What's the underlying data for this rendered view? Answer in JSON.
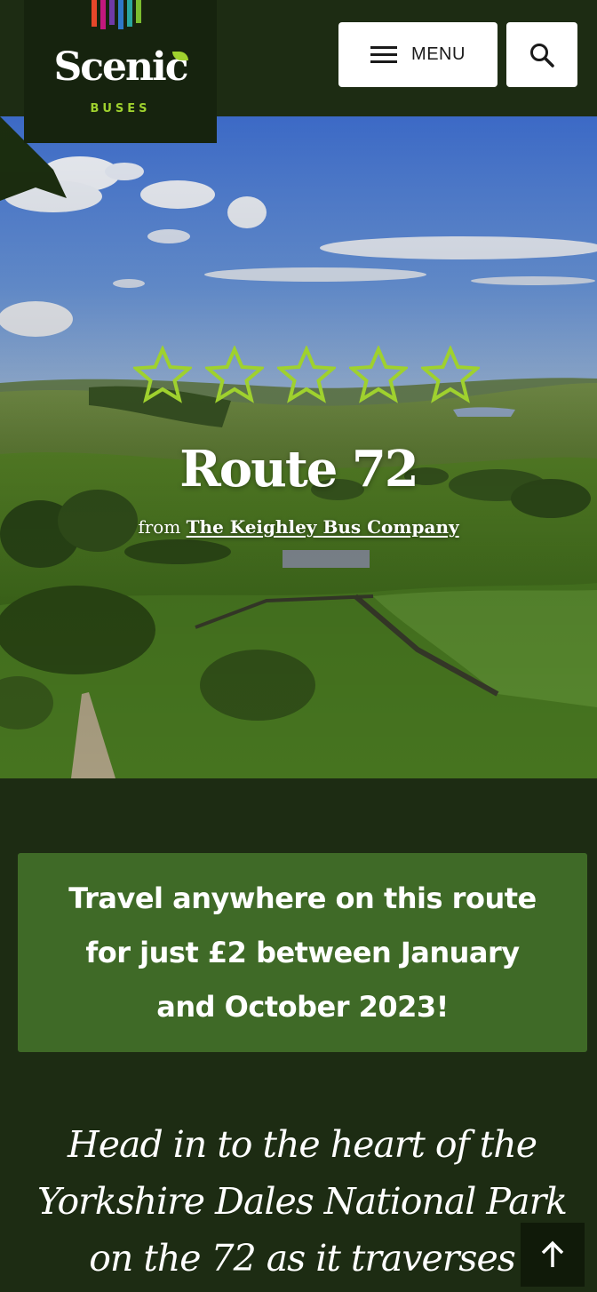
{
  "logo": {
    "word": "Scenic",
    "sub": "BUSES",
    "stripe_colors": [
      "#e5472a",
      "#c2187d",
      "#6f3aa8",
      "#2f78c9",
      "#29a6a0",
      "#7bbd2f"
    ]
  },
  "header": {
    "menu_label": "MENU",
    "search_icon": "search-icon",
    "menu_icon": "hamburger-icon"
  },
  "hero": {
    "rating": {
      "stars": 5,
      "out_of": 5
    },
    "star_color": "#9fd12e",
    "title": "Route 72",
    "from_prefix": "from",
    "operator": "The Keighley Bus Company"
  },
  "promo": {
    "text": "Travel anywhere on this route for just £2 between January and October 2023!"
  },
  "intro": {
    "text": "Head in to the heart of the Yorkshire Dales National Park on the 72 as it traverses"
  },
  "back_to_top_icon": "arrow-up-icon",
  "colors": {
    "page_bg": "#1d2c13",
    "promo_bg": "#3f6a27",
    "accent": "#9fd12e"
  }
}
